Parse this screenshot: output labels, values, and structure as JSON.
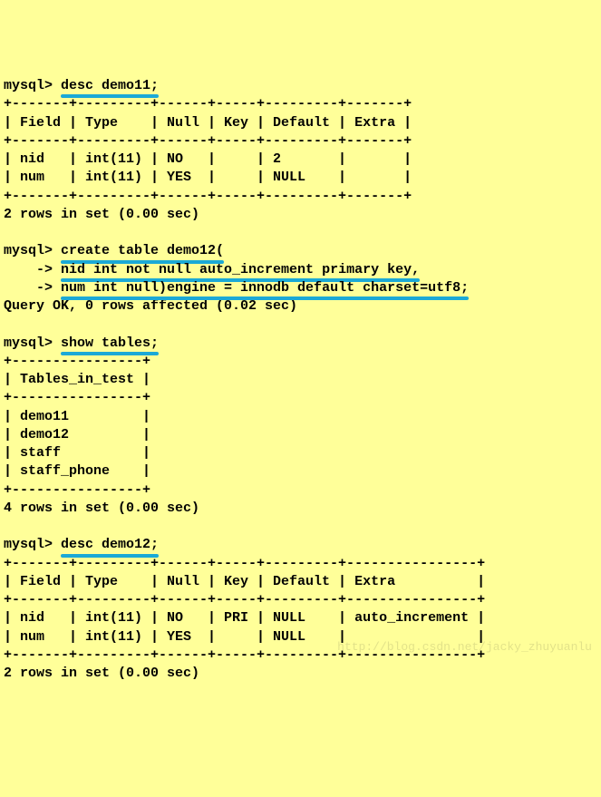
{
  "block1": {
    "cmd_prefix": "mysql> ",
    "cmd": "desc demo11;",
    "sep": "+-------+---------+------+-----+---------+-------+",
    "hdr": "| Field | Type    | Null | Key | Default | Extra |",
    "r1": "| nid   | int(11) | NO   |     | 2       |       |",
    "r2": "| num   | int(11) | YES  |     | NULL    |       |",
    "result": "2 rows in set (0.00 sec)"
  },
  "block2": {
    "cmd_prefix": "mysql> ",
    "cmd": "create table demo12(",
    "line1_prefix": "    -> ",
    "line1": "nid int not null auto_increment primary key,",
    "line2_prefix": "    -> ",
    "line2": "num int null)engine = innodb default charset=utf8;",
    "result": "Query OK, 0 rows affected (0.02 sec)"
  },
  "block3": {
    "cmd_prefix": "mysql> ",
    "cmd": "show tables;",
    "sep": "+----------------+",
    "hdr": "| Tables_in_test |",
    "r1": "| demo11         |",
    "r2": "| demo12         |",
    "r3": "| staff          |",
    "r4": "| staff_phone    |",
    "result": "4 rows in set (0.00 sec)"
  },
  "block4": {
    "cmd_prefix": "mysql> ",
    "cmd": "desc demo12;",
    "sep": "+-------+---------+------+-----+---------+----------------+",
    "hdr": "| Field | Type    | Null | Key | Default | Extra          |",
    "r1": "| nid   | int(11) | NO   | PRI | NULL    | auto_increment |",
    "r2": "| num   | int(11) | YES  |     | NULL    |                |",
    "result": "2 rows in set (0.00 sec)"
  },
  "watermark": "http://blog.csdn.net/jacky_zhuyuanlu"
}
